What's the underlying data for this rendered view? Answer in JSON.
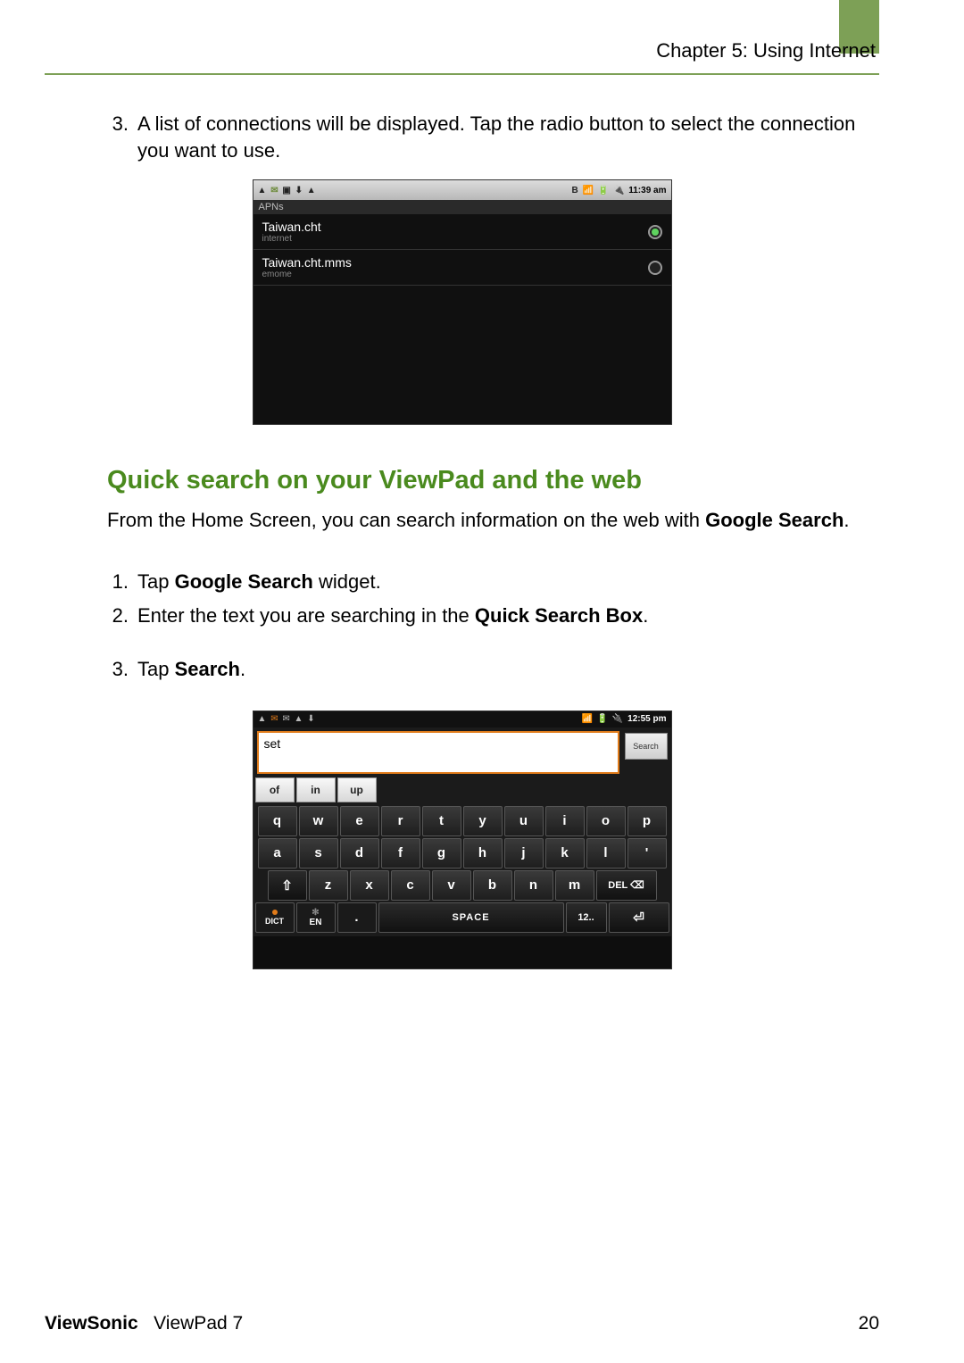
{
  "chapter": "Chapter 5: Using Internet",
  "step3": {
    "num": "3.",
    "text": "A list of connections will be displayed. Tap the radio button to select the connection you want to use."
  },
  "apn_shot": {
    "status_left_icons": [
      "▲",
      "✉",
      "▣",
      "⬇",
      "▲"
    ],
    "status_right_icons": [
      "B",
      "📶",
      "🔋",
      "🔌"
    ],
    "time": "11:39 am",
    "header": "APNs",
    "items": [
      {
        "name": "Taiwan.cht",
        "sub": "internet",
        "selected": true
      },
      {
        "name": "Taiwan.cht.mms",
        "sub": "emome",
        "selected": false
      }
    ]
  },
  "section_heading": "Quick search on your ViewPad and the web",
  "section_para_a": "From the Home Screen, you can search information on the web with ",
  "section_para_b": "Google Search",
  "section_para_c": ".",
  "steps": [
    {
      "num": "1.",
      "a": "Tap ",
      "b": "Google Search",
      "c": " widget."
    },
    {
      "num": "2.",
      "a": "Enter the text you are searching in the ",
      "b": "Quick Search Box",
      "c": "."
    },
    {
      "num": "3.",
      "a": "Tap ",
      "b": "Search",
      "c": "."
    }
  ],
  "search_shot": {
    "status_left_icons": [
      "▲",
      "✉",
      "✉",
      "▲",
      "⬇"
    ],
    "status_right_icons": [
      "📶",
      "🔋",
      "🔌"
    ],
    "time": "12:55 pm",
    "input_value": "set",
    "search_button": "Search",
    "suggestions": [
      "of",
      "in",
      "up"
    ],
    "rows": [
      [
        "q",
        "w",
        "e",
        "r",
        "t",
        "y",
        "u",
        "i",
        "o",
        "p"
      ],
      [
        "a",
        "s",
        "d",
        "f",
        "g",
        "h",
        "j",
        "k",
        "l",
        "'"
      ]
    ],
    "row3": {
      "shift": "⇧",
      "keys": [
        "z",
        "x",
        "c",
        "v",
        "b",
        "n",
        "m"
      ],
      "del": "DEL ⌫"
    },
    "row4": {
      "dict": "DICT",
      "en": "EN",
      "period": ".",
      "space": "SPACE",
      "num": "12..",
      "enter": "⏎"
    }
  },
  "footer": {
    "brand_bold": "ViewSonic",
    "brand_rest": "ViewPad 7",
    "page": "20"
  }
}
